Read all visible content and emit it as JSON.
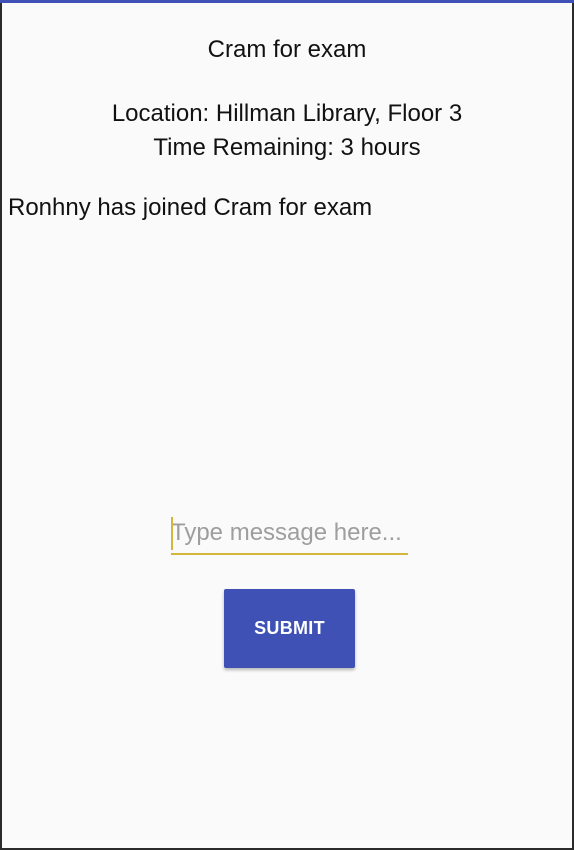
{
  "session": {
    "title": "Cram for exam",
    "location_text": "Location: Hillman Library, Floor 3",
    "time_remaining_text": "Time Remaining: 3 hours"
  },
  "messages": [
    {
      "text": "Ronhny has joined Cram for exam"
    }
  ],
  "composer": {
    "placeholder": "Type message here...",
    "value": "",
    "submit_label": "SUBMIT"
  },
  "colors": {
    "primary": "#3f51b5",
    "input_accent": "#d4b63a",
    "background": "#fafafa"
  }
}
